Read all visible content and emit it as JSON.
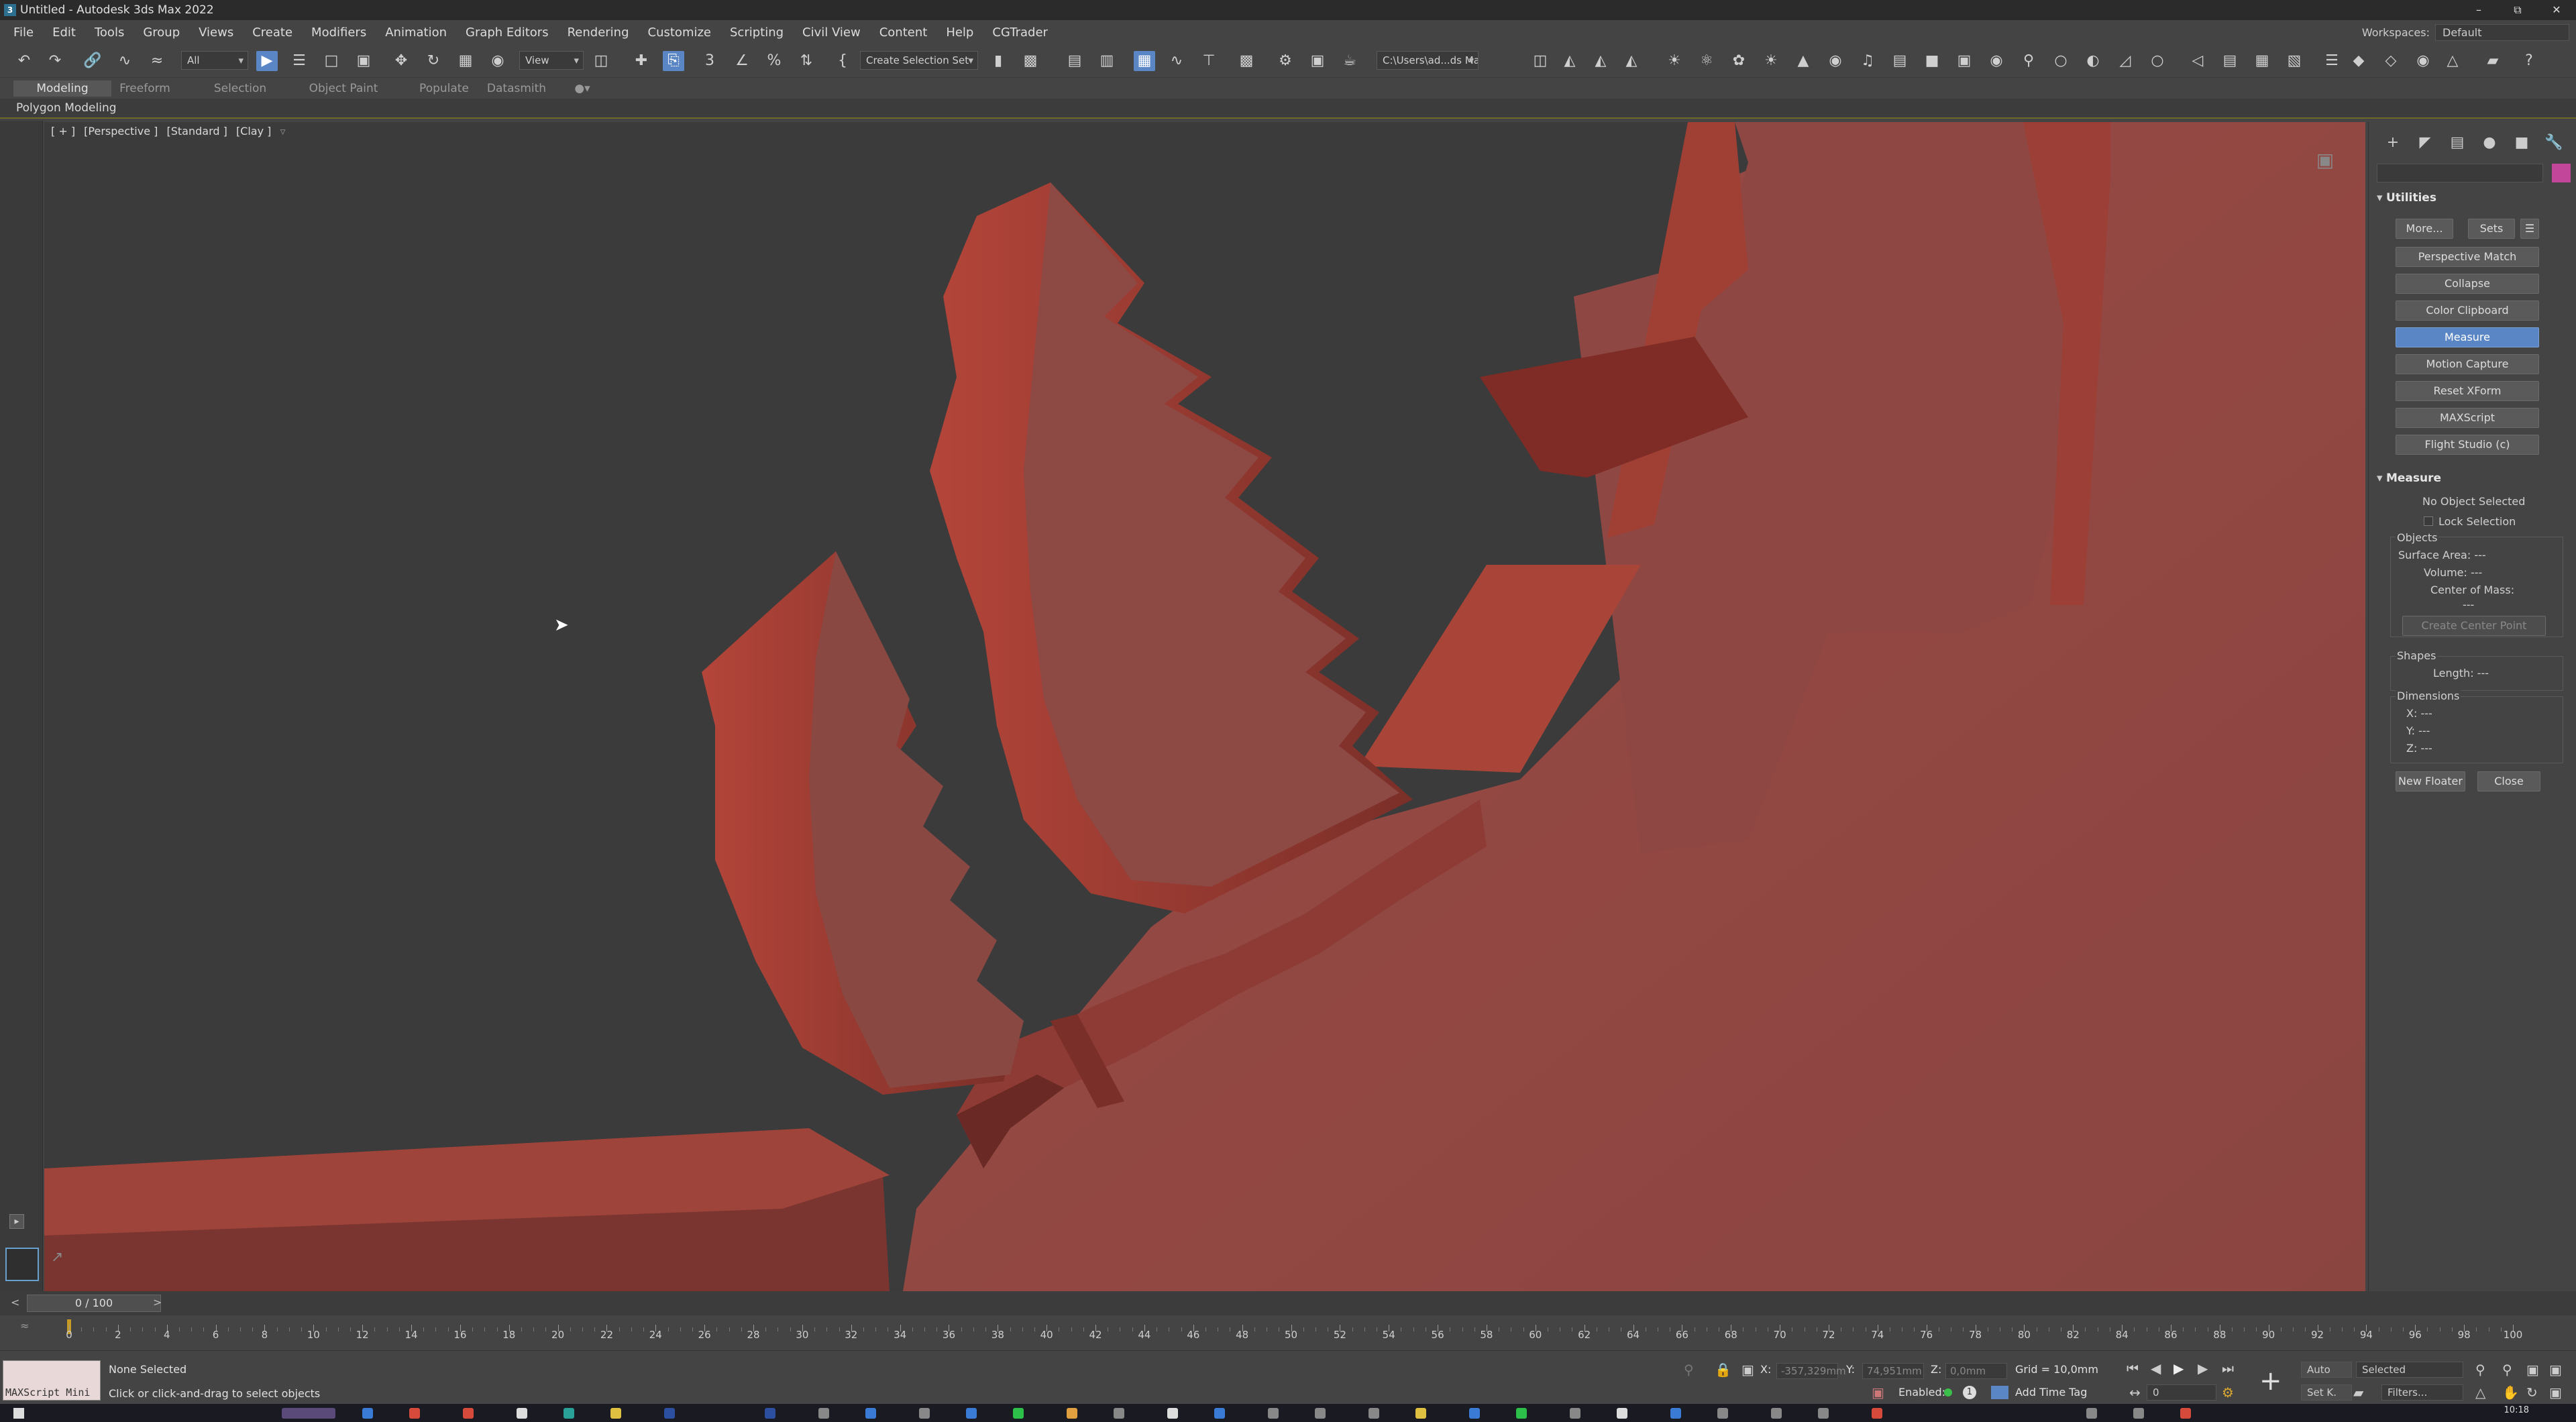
{
  "window": {
    "title": "Untitled - Autodesk 3ds Max 2022",
    "minimize": "–",
    "restore": "⧉",
    "close": "✕"
  },
  "menubar": {
    "items": [
      "File",
      "Edit",
      "Tools",
      "Group",
      "Views",
      "Create",
      "Modifiers",
      "Animation",
      "Graph Editors",
      "Rendering",
      "Customize",
      "Scripting",
      "Civil View",
      "Content",
      "Help",
      "CGTrader"
    ],
    "workspaces_label": "Workspaces:",
    "workspaces_value": "Default"
  },
  "toolbar": {
    "selection_filter": "All",
    "reference_coord": "View",
    "named_selection": "Create Selection Set",
    "project_path": "C:\\Users\\ad...ds Max 2022"
  },
  "ribbon": {
    "tabs": [
      "Modeling",
      "Freeform",
      "Selection",
      "Object Paint",
      "Populate",
      "Datasmith"
    ],
    "panel_label": "Polygon Modeling"
  },
  "viewport": {
    "labels": [
      "[ + ]",
      "[Perspective ]",
      "[Standard ]",
      "[Clay ]"
    ],
    "colors": {
      "background": "#3b3b3b",
      "clay": "#8c4a46",
      "clay_light": "#a3524a",
      "clay_dark": "#5e2a26"
    }
  },
  "command_panel": {
    "utilities": {
      "header": "Utilities",
      "more": "More...",
      "sets": "Sets",
      "buttons": [
        "Perspective Match",
        "Collapse",
        "Color Clipboard",
        "Measure",
        "Motion Capture",
        "Reset XForm",
        "MAXScript",
        "Flight Studio (c)"
      ],
      "selected": "Measure"
    },
    "measure": {
      "header": "Measure",
      "status": "No Object Selected",
      "lock_selection": "Lock Selection",
      "objects_label": "Objects",
      "surface_area": "Surface Area:  ---",
      "volume": "Volume:  ---",
      "center_of_mass": "Center of Mass:",
      "center_value": "---",
      "create_center_point": "Create Center Point",
      "shapes_label": "Shapes",
      "length": "Length:  ---",
      "dimensions_label": "Dimensions",
      "x": "X:  ---",
      "y": "Y:  ---",
      "z": "Z:  ---",
      "new_floater": "New Floater",
      "close": "Close"
    },
    "color_swatch": "#c2479b"
  },
  "timeline": {
    "slider_label": "0 / 100",
    "ticks": [
      "0",
      "2",
      "4",
      "6",
      "8",
      "10",
      "12",
      "14",
      "16",
      "18",
      "20",
      "22",
      "24",
      "26",
      "28",
      "30",
      "32",
      "34",
      "36",
      "38",
      "40",
      "42",
      "44",
      "46",
      "48",
      "50",
      "52",
      "54",
      "56",
      "58",
      "60",
      "62",
      "64",
      "66",
      "68",
      "70",
      "72",
      "74",
      "76",
      "78",
      "80",
      "82",
      "84",
      "86",
      "88",
      "90",
      "92",
      "94",
      "96",
      "98",
      "100"
    ]
  },
  "status": {
    "maxscript_label": "MAXScript Mini",
    "selection": "None Selected",
    "prompt": "Click or click-and-drag to select objects",
    "x_label": "X:",
    "x_value": "-357,329mm",
    "y_label": "Y:",
    "y_value": "74,951mm",
    "z_label": "Z:",
    "z_value": "0,0mm",
    "grid": "Grid = 10,0mm",
    "enabled": "Enabled:",
    "add_time_tag": "Add Time Tag",
    "auto": "Auto",
    "set_key": "Set K.",
    "key_filter": "Selected",
    "filters": "Filters...",
    "frame": "0"
  },
  "taskbar": {
    "time": "10:18"
  }
}
